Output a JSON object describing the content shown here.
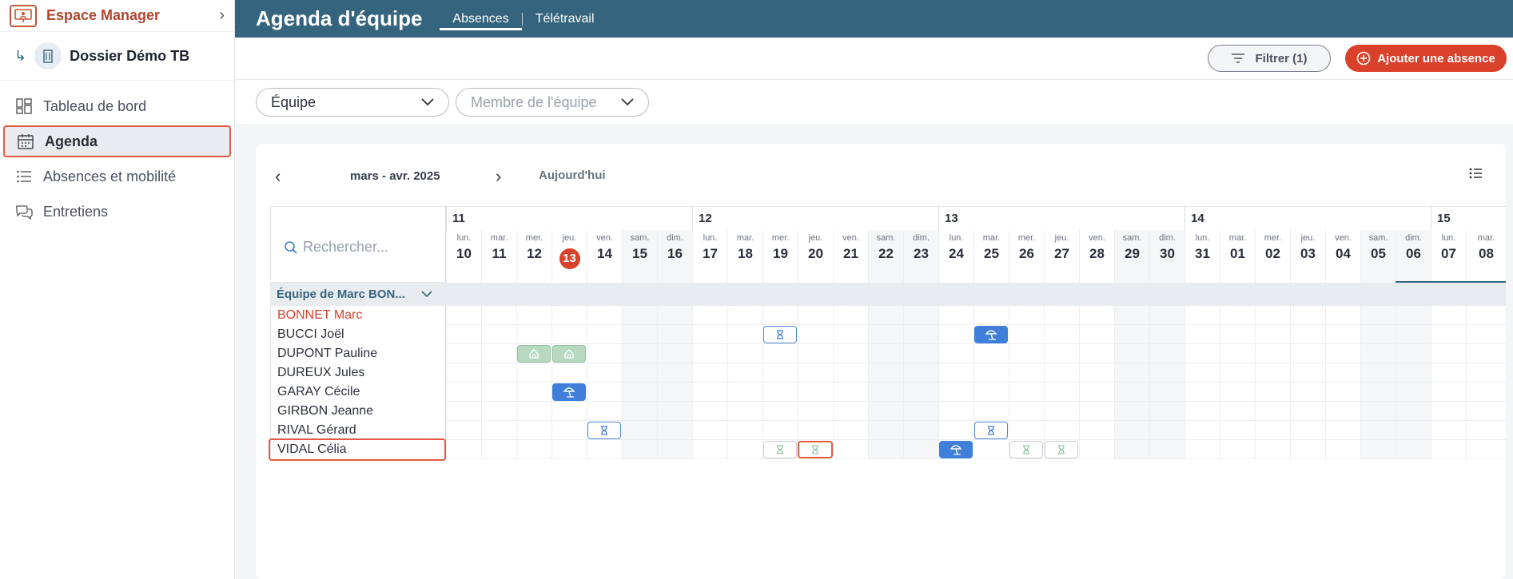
{
  "sidebar": {
    "app_title": "Espace Manager",
    "dossier": "Dossier Démo TB",
    "items": [
      {
        "label": "Tableau de bord",
        "icon": "dashboard-icon"
      },
      {
        "label": "Agenda",
        "icon": "calendar-icon",
        "active": true
      },
      {
        "label": "Absences et mobilité",
        "icon": "list-icon"
      },
      {
        "label": "Entretiens",
        "icon": "chat-icon"
      }
    ]
  },
  "header": {
    "title": "Agenda d'équipe",
    "tabs": [
      {
        "label": "Absences",
        "active": true
      },
      {
        "label": "Télétravail",
        "active": false
      }
    ]
  },
  "actions": {
    "filter_label": "Filtrer (1)",
    "add_label": "Ajouter une absence"
  },
  "filters": {
    "team_select": "Équipe",
    "member_placeholder": "Membre de l'équipe"
  },
  "calendar": {
    "period": "mars - avr. 2025",
    "today_label": "Aujourd'hui",
    "search_placeholder": "Rechercher...",
    "weeks": [
      "11",
      "12",
      "13",
      "14",
      "15"
    ],
    "days": [
      {
        "n": "lun.",
        "d": "10"
      },
      {
        "n": "mar.",
        "d": "11"
      },
      {
        "n": "mer.",
        "d": "12"
      },
      {
        "n": "jeu.",
        "d": "13",
        "today": true
      },
      {
        "n": "ven.",
        "d": "14"
      },
      {
        "n": "sam.",
        "d": "15",
        "we": true
      },
      {
        "n": "dim.",
        "d": "16",
        "we": true
      },
      {
        "n": "lun.",
        "d": "17"
      },
      {
        "n": "mar.",
        "d": "18"
      },
      {
        "n": "mer.",
        "d": "19"
      },
      {
        "n": "jeu.",
        "d": "20"
      },
      {
        "n": "ven.",
        "d": "21"
      },
      {
        "n": "sam.",
        "d": "22",
        "we": true
      },
      {
        "n": "dim.",
        "d": "23",
        "we": true
      },
      {
        "n": "lun.",
        "d": "24"
      },
      {
        "n": "mar.",
        "d": "25"
      },
      {
        "n": "mer.",
        "d": "26"
      },
      {
        "n": "jeu.",
        "d": "27"
      },
      {
        "n": "ven.",
        "d": "28"
      },
      {
        "n": "sam.",
        "d": "29",
        "we": true
      },
      {
        "n": "dim.",
        "d": "30",
        "we": true
      },
      {
        "n": "lun.",
        "d": "31"
      },
      {
        "n": "mar.",
        "d": "01"
      },
      {
        "n": "mer.",
        "d": "02"
      },
      {
        "n": "jeu.",
        "d": "03"
      },
      {
        "n": "ven.",
        "d": "04"
      },
      {
        "n": "sam.",
        "d": "05",
        "we": true
      },
      {
        "n": "dim.",
        "d": "06",
        "we": true
      },
      {
        "n": "lun.",
        "d": "07"
      },
      {
        "n": "mar.",
        "d": "08"
      }
    ],
    "group": "Équipe de Marc BON...",
    "members": [
      {
        "name": "BONNET Marc",
        "color": "#d9412b"
      },
      {
        "name": "BUCCI Joël"
      },
      {
        "name": "DUPONT Pauline"
      },
      {
        "name": "DUREUX Jules"
      },
      {
        "name": "GARAY Cécile"
      },
      {
        "name": "GIRBON Jeanne"
      },
      {
        "name": "RIVAL Gérard"
      },
      {
        "name": "VIDAL Célia"
      }
    ],
    "events": [
      {
        "member": 1,
        "day": 9,
        "kind": "outline",
        "icon": "hourglass-icon"
      },
      {
        "member": 1,
        "day": 15,
        "kind": "blue",
        "icon": "beach-umbrella-icon"
      },
      {
        "member": 2,
        "day": 2,
        "kind": "green",
        "icon": "home-icon"
      },
      {
        "member": 2,
        "day": 3,
        "kind": "green",
        "icon": "home-icon"
      },
      {
        "member": 4,
        "day": 3,
        "kind": "blue",
        "icon": "beach-umbrella-icon"
      },
      {
        "member": 6,
        "day": 4,
        "kind": "outline",
        "icon": "hourglass-icon"
      },
      {
        "member": 6,
        "day": 15,
        "kind": "outline",
        "icon": "hourglass-icon"
      },
      {
        "member": 7,
        "day": 9,
        "kind": "light",
        "icon": "hourglass-icon"
      },
      {
        "member": 7,
        "day": 10,
        "kind": "light",
        "icon": "hourglass-icon",
        "highlight": true
      },
      {
        "member": 7,
        "day": 14,
        "kind": "blue",
        "icon": "beach-umbrella-icon"
      },
      {
        "member": 7,
        "day": 16,
        "kind": "light",
        "icon": "hourglass-icon"
      },
      {
        "member": 7,
        "day": 17,
        "kind": "light",
        "icon": "hourglass-icon"
      }
    ]
  }
}
